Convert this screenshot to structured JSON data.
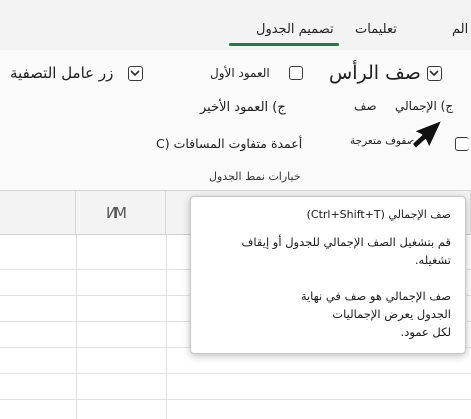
{
  "tabs": {
    "partial": "الم",
    "help": "تعليمات",
    "table_design": "تصميم الجدول"
  },
  "ribbon": {
    "header_row": "صف الرأس",
    "first_column": "العمود الأول",
    "filter_button": "زر عامل التصفية",
    "total_row": "ج) الإجمالي",
    "total_row_suffix": "صف",
    "last_column": "ج) العمود الأخير",
    "banded_rows": "صفوف متعرجة",
    "banded_columns": "C) أعمدة متفاوت المسافات",
    "group_label": "خيارات نمط الجدول"
  },
  "sheet": {
    "columns": [
      "И",
      "M"
    ]
  },
  "tooltip": {
    "title": "صف الإجمالي (Ctrl+Shift+T)",
    "line1": "قم بتشغيل الصف الإجمالي للجدول أو إيقاف",
    "line2": "تشغيله.",
    "line3": "صف الإجمالي هو صف في نهاية",
    "line4": "الجدول يعرض الإجماليات",
    "line5": "لكل عمود."
  },
  "colors": {
    "accent": "#1a7f3c",
    "ribbon_bg": "#fafafa",
    "tooltip_bg": "#ffffff"
  }
}
